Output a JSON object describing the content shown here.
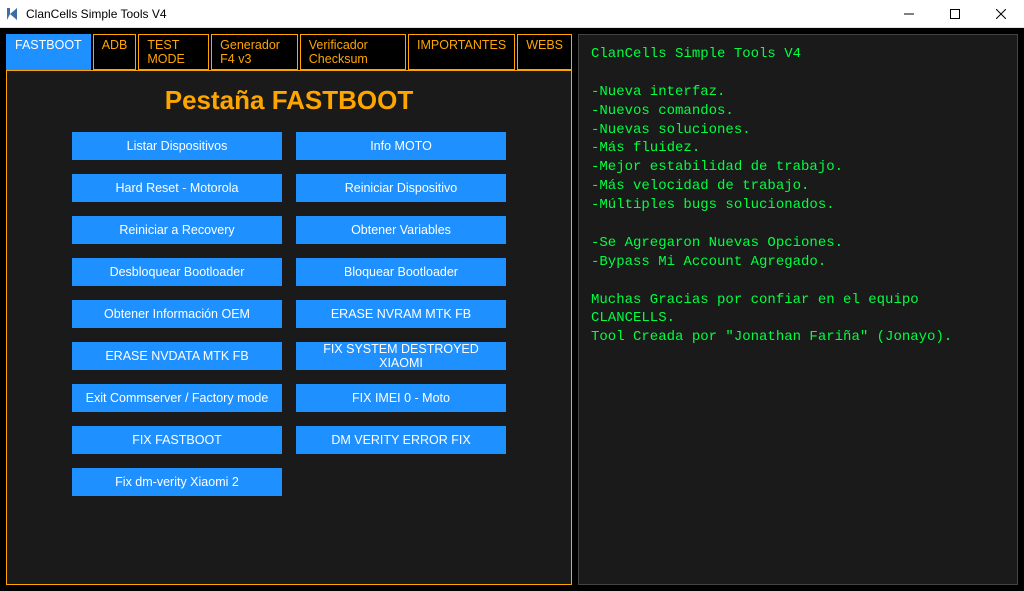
{
  "window": {
    "title": "ClanCells Simple Tools V4"
  },
  "tabs": [
    {
      "label": "FASTBOOT",
      "active": true
    },
    {
      "label": "ADB",
      "active": false
    },
    {
      "label": "TEST MODE",
      "active": false
    },
    {
      "label": "Generador F4 v3",
      "active": false
    },
    {
      "label": "Verificador Checksum",
      "active": false
    },
    {
      "label": "IMPORTANTES",
      "active": false
    },
    {
      "label": "WEBS",
      "active": false
    }
  ],
  "panel": {
    "title": "Pestaña FASTBOOT",
    "buttons_col1": [
      "Listar Dispositivos",
      "Hard Reset - Motorola",
      "Reiniciar a Recovery",
      "Desbloquear Bootloader",
      "Obtener Información OEM",
      "ERASE NVDATA MTK FB",
      "Exit Commserver / Factory mode",
      "FIX FASTBOOT",
      "Fix dm-verity Xiaomi 2"
    ],
    "buttons_col2": [
      "Info MOTO",
      "Reiniciar Dispositivo",
      "Obtener Variables",
      "Bloquear Bootloader",
      "ERASE NVRAM MTK FB",
      "FIX SYSTEM DESTROYED XIAOMI",
      "FIX IMEI 0 - Moto",
      "DM VERITY ERROR FIX"
    ]
  },
  "console": {
    "lines": [
      "ClanCells Simple Tools V4",
      "",
      "-Nueva interfaz.",
      "-Nuevos comandos.",
      "-Nuevas soluciones.",
      "-Más fluidez.",
      "-Mejor estabilidad de trabajo.",
      "-Más velocidad de trabajo.",
      "-Múltiples bugs solucionados.",
      "",
      "-Se Agregaron Nuevas Opciones.",
      "-Bypass Mi Account Agregado.",
      "",
      "Muchas Gracias por confiar en el equipo CLANCELLS.",
      "Tool Creada por \"Jonathan Fariña\" (Jonayo)."
    ]
  }
}
